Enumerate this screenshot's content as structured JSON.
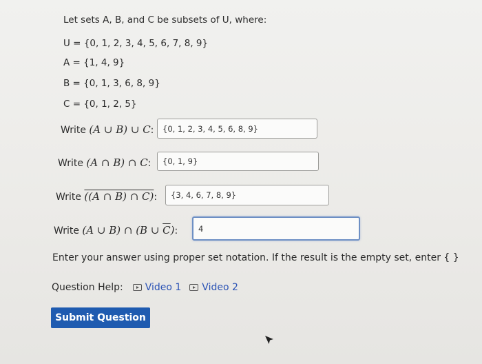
{
  "intro": "Let sets A, B, and C be subsets of U, where:",
  "sets": {
    "U": "U = {0, 1, 2, 3, 4, 5, 6, 7, 8, 9}",
    "A": "A = {1, 4, 9}",
    "B": "B = {0, 1, 3, 6, 8, 9}",
    "C": "C = {0, 1, 2, 5}"
  },
  "questions": [
    {
      "prefix": "Write ",
      "expr": "(A ∪ B) ∪ C",
      "answer": "{0, 1, 2, 3, 4, 5, 6, 8, 9}"
    },
    {
      "prefix": "Write ",
      "expr": "(A ∩ B) ∩ C",
      "answer": "{0, 1, 9}"
    },
    {
      "prefix": "Write ",
      "expr": "((A ∩ B) ∩ C)",
      "answer": "{3, 4, 6, 7, 8, 9}"
    },
    {
      "prefix": "Write ",
      "expr_a": "(A ∪ B) ∩ (B ∪ ",
      "expr_bar": "C",
      "expr_b": ")",
      "answer": "4"
    }
  ],
  "instruction": "Enter your answer using proper set notation. If the result is the empty set, enter { }",
  "help": {
    "label": "Question Help:",
    "video1": "Video 1",
    "video2": "Video 2"
  },
  "submit_label": "Submit Question"
}
